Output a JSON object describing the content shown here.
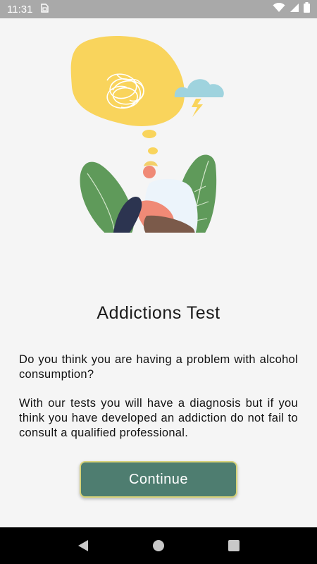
{
  "status_bar": {
    "time": "11:31",
    "sim_icon": "sim-card-icon",
    "right_icons": [
      "wifi-icon",
      "signal-icon",
      "battery-icon"
    ]
  },
  "main": {
    "illustration": "sad-person-with-tangled-thoughts-illustration",
    "title": "Addictions Test",
    "paragraph_1": "Do you think you are having a problem with alcohol consumption?",
    "paragraph_2": "With our tests you will have a diagnosis but if you think you have developed an addiction do not fail to consult a qualified professional.",
    "continue_label": "Continue"
  },
  "colors": {
    "button_bg": "#4e7d70",
    "button_border": "#d8d37a",
    "thought_bubble": "#f9d45c",
    "cloud": "#9fd3de",
    "leaf": "#5f9a5a"
  },
  "nav_bar": {
    "icons": [
      "back-icon",
      "home-icon",
      "recents-icon"
    ]
  }
}
